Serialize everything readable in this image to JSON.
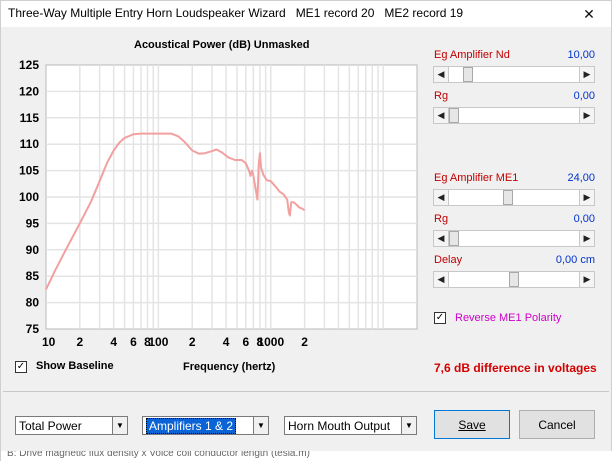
{
  "window": {
    "title": "Three-Way Multiple Entry Horn Loudspeaker Wizard",
    "me1_record": "ME1 record 20",
    "me2_record": "ME2 record 19",
    "close_glyph": "✕"
  },
  "chart_data": {
    "type": "line",
    "title": "Acoustical Power (dB)   Unmasked",
    "xlabel": "Frequency (hertz)",
    "ylabel": "",
    "x_scale": "log",
    "xlim": [
      10,
      20000
    ],
    "ylim": [
      75,
      125
    ],
    "y_ticks": [
      75,
      80,
      85,
      90,
      95,
      100,
      105,
      110,
      115,
      120,
      125
    ],
    "x_tick_labels": [
      {
        "value": 10,
        "label": "10"
      },
      {
        "value": 20,
        "label": "2"
      },
      {
        "value": 40,
        "label": "4"
      },
      {
        "value": 60,
        "label": "6"
      },
      {
        "value": 80,
        "label": "8"
      },
      {
        "value": 100,
        "label": "100"
      },
      {
        "value": 200,
        "label": "2"
      },
      {
        "value": 400,
        "label": "4"
      },
      {
        "value": 600,
        "label": "6"
      },
      {
        "value": 800,
        "label": "8"
      },
      {
        "value": 1000,
        "label": "1000"
      },
      {
        "value": 2000,
        "label": "2"
      }
    ],
    "grid": true,
    "line_color": "#f2a0a0",
    "series": [
      {
        "values_xy": [
          [
            10,
            82.5
          ],
          [
            12,
            86
          ],
          [
            15,
            90
          ],
          [
            20,
            95
          ],
          [
            25,
            99
          ],
          [
            30,
            103
          ],
          [
            35,
            106.5
          ],
          [
            40,
            108.8
          ],
          [
            45,
            110.3
          ],
          [
            50,
            111.2
          ],
          [
            60,
            111.9
          ],
          [
            70,
            112
          ],
          [
            100,
            112
          ],
          [
            130,
            112
          ],
          [
            150,
            111.5
          ],
          [
            170,
            110.5
          ],
          [
            200,
            108.8
          ],
          [
            230,
            108.2
          ],
          [
            260,
            108.3
          ],
          [
            300,
            108.7
          ],
          [
            330,
            109
          ],
          [
            370,
            108.4
          ],
          [
            420,
            107.5
          ],
          [
            480,
            107
          ],
          [
            550,
            107
          ],
          [
            600,
            106.4
          ],
          [
            640,
            105
          ],
          [
            660,
            104
          ],
          [
            680,
            105
          ],
          [
            700,
            104
          ],
          [
            720,
            102.5
          ],
          [
            740,
            101
          ],
          [
            760,
            99.5
          ],
          [
            780,
            106
          ],
          [
            800,
            108.3
          ],
          [
            820,
            105.5
          ],
          [
            860,
            104.2
          ],
          [
            920,
            103.2
          ],
          [
            1000,
            103
          ],
          [
            1100,
            102
          ],
          [
            1200,
            101
          ],
          [
            1300,
            100.5
          ],
          [
            1400,
            99.5
          ],
          [
            1450,
            97
          ],
          [
            1480,
            96.5
          ],
          [
            1520,
            99
          ],
          [
            1600,
            99
          ],
          [
            1700,
            98.5
          ],
          [
            1800,
            98
          ],
          [
            1900,
            97.8
          ],
          [
            2000,
            97.5
          ]
        ]
      }
    ]
  },
  "controls": {
    "eg_amp_nd": {
      "label": "Eg  Amplifier  Nd",
      "value": "10,00",
      "fraction": 0.12
    },
    "rg1": {
      "label": "Rg",
      "value": "0,00",
      "fraction": 0.0
    },
    "eg_amp_me1": {
      "label": "Eg  Amplifier  ME1",
      "value": "24,00",
      "fraction": 0.45
    },
    "rg2": {
      "label": "Rg",
      "value": "0,00",
      "fraction": 0.0
    },
    "delay": {
      "label": "Delay",
      "value": "0,00 cm",
      "fraction": 0.5
    },
    "reverse_me1": {
      "label": "Reverse ME1 Polarity",
      "checked": true,
      "color": "#cc00cc"
    }
  },
  "show_baseline": {
    "label": "Show Baseline",
    "checked": true
  },
  "diff_text": "7,6 dB difference in voltages",
  "selects": {
    "power": "Total Power",
    "amplifiers": "Amplifiers 1 & 2",
    "output": "Horn Mouth Output"
  },
  "buttons": {
    "save": "Save",
    "cancel": "Cancel"
  },
  "icons": {
    "check": "✓",
    "left_arrow": "◀",
    "right_arrow": "▶",
    "dropdown": "▼"
  },
  "footer_text": "B: Drive magnetic flux density x Voice coil conductor length  (tesla.m)"
}
